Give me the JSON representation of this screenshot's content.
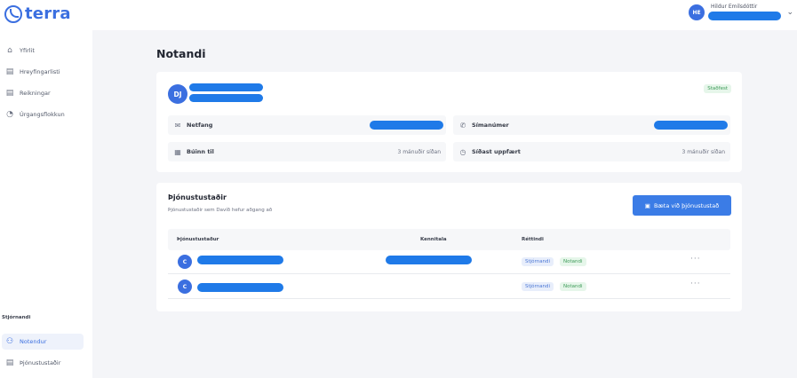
{
  "app": {
    "logo_text": "terra",
    "accent_color": "#3b6fe0",
    "redaction_color": "#1f7ae8"
  },
  "topbar": {
    "user_initials": "HE",
    "user_name": "Hildur Emilsdóttir",
    "chevron_icon": "chevron-down-icon"
  },
  "sidebar": {
    "items": [
      {
        "label": "Yfirlit",
        "icon": "home-icon"
      },
      {
        "label": "Hreyfingarlisti",
        "icon": "list-icon"
      },
      {
        "label": "Reikningar",
        "icon": "document-icon"
      },
      {
        "label": "Úrgangsflokkun",
        "icon": "pie-chart-icon"
      }
    ],
    "admin_section_label": "Stjórnandi",
    "admin_items": [
      {
        "label": "Notendur",
        "icon": "users-icon",
        "active": true
      },
      {
        "label": "Þjónustustaðir",
        "icon": "document-icon"
      }
    ]
  },
  "page": {
    "title": "Notandi"
  },
  "user_card": {
    "initials": "DJ",
    "status_badge": "Staðfest",
    "fields": {
      "email_label": "Netfang",
      "phone_label": "Símanúmer",
      "created_label": "Búinn til",
      "created_value": "3 mánuðir síðan",
      "updated_label": "Síðast uppfært",
      "updated_value": "3 mánuðir síðan"
    }
  },
  "locations_card": {
    "title": "Þjónustustaðir",
    "subtitle": "Þjónustustaðir sem Davíð hefur aðgang að",
    "add_button": "Bæta við þjónustustað",
    "columns": [
      "Þjónustustaður",
      "Kennitala",
      "Réttindi"
    ],
    "rows": [
      {
        "initial": "C",
        "roles": [
          "Stjórnandi",
          "Notandi"
        ],
        "more": "···"
      },
      {
        "initial": "C",
        "roles": [
          "Stjórnandi",
          "Notandi"
        ],
        "more": "···"
      }
    ]
  }
}
